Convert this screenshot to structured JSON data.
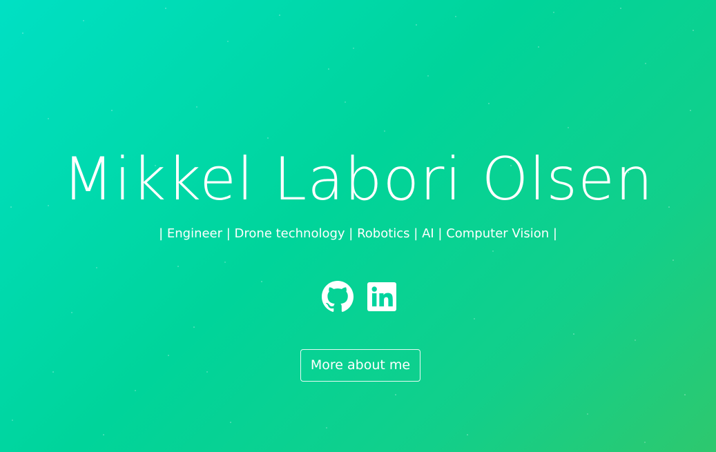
{
  "hero": {
    "name": "Mikkel Labori Olsen",
    "tagline": "| Engineer | Drone technology | Robotics | AI | Computer Vision |"
  },
  "social": {
    "items": [
      {
        "icon": "github-icon"
      },
      {
        "icon": "linkedin-icon"
      }
    ]
  },
  "cta": {
    "label": "More about me"
  },
  "colors": {
    "gradient_start": "#00e0c4",
    "gradient_end": "#2ec86e",
    "text": "#ffffff"
  }
}
